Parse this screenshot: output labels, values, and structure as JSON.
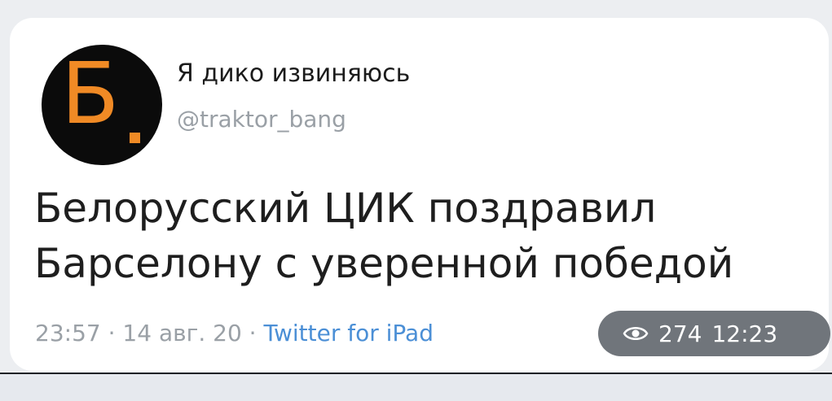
{
  "tweet": {
    "avatar_letter": "Б",
    "display_name": "Я дико извиняюсь",
    "handle": "@traktor_bang",
    "text_lines": [
      "Белорусский ЦИК поздравил",
      "Барселону с уверенной победой"
    ],
    "time": "23:57",
    "separator": "·",
    "date": "14 авг. 20",
    "source": "Twitter for iPad"
  },
  "overlay": {
    "icon": "eye-icon",
    "views": "274",
    "time": "12:23"
  },
  "colors": {
    "avatar_bg": "#0b0b0b",
    "avatar_letter": "#f08a25",
    "source_link": "#4b8fd6",
    "pill_bg": "#70757b"
  }
}
